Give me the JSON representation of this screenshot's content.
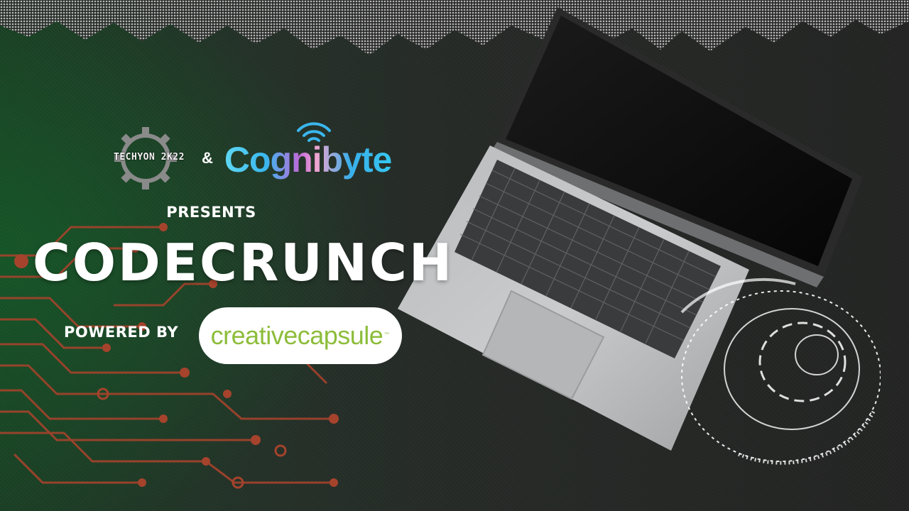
{
  "colors": {
    "title_text": "#ffffff",
    "sponsor_green": "#8dbd3b",
    "circuit_red": "#a5432c",
    "cognibyte_blue": "#3ab6ee"
  },
  "logos": {
    "techyon": "TECHYON 2K22",
    "ampersand": "&",
    "cognibyte": "Cognibyte"
  },
  "header": {
    "presents": "PRESENTS",
    "title": "CODECRUNCH"
  },
  "sponsor": {
    "powered_by": "POWERED BY",
    "name": "creativecapsule",
    "trademark": "™"
  },
  "icons": [
    "gear-icon",
    "wifi-icon",
    "laptop-illustration",
    "circuit-decoration",
    "hud-rings-decoration"
  ]
}
